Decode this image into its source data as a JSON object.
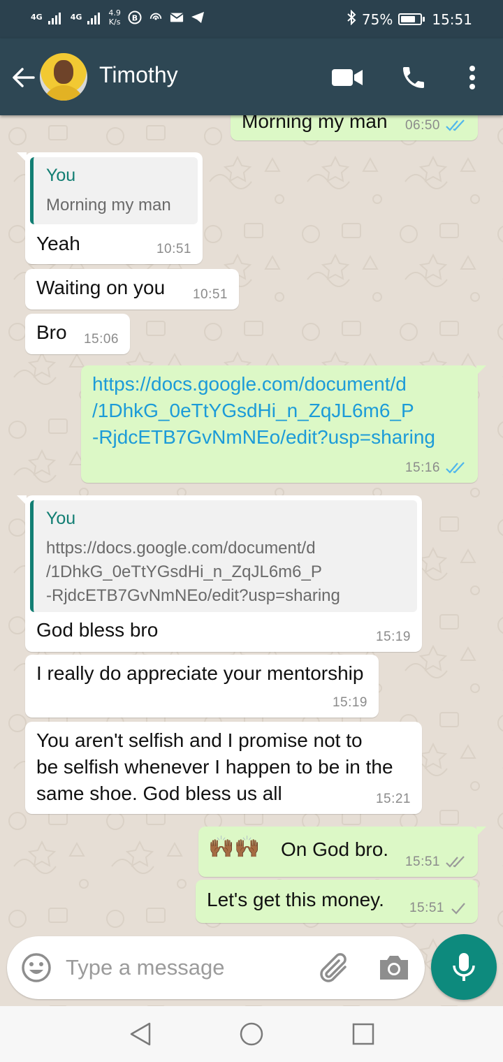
{
  "status_bar": {
    "network_1": "4G",
    "network_2": "4G",
    "speed_value": "4.9",
    "speed_unit": "K/s",
    "battery": "75%",
    "battery_level": 0.75,
    "time": "15:51"
  },
  "header": {
    "contact_name": "Timothy",
    "icons": [
      "back-arrow-icon",
      "video-call-icon",
      "phone-icon",
      "more-vert-icon"
    ]
  },
  "messages": {
    "m0": {
      "text": "Morning my man",
      "time": "06:50",
      "status": "read"
    },
    "m1": {
      "quote_author": "You",
      "quote_text": "Morning my man",
      "text": "Yeah",
      "time": "10:51"
    },
    "m2": {
      "text": "Waiting on you",
      "time": "10:51"
    },
    "m3": {
      "text": "Bro",
      "time": "15:06"
    },
    "m4": {
      "line1": "https://docs.google.com/document/d",
      "line2": "/1DhkG_0eTtYGsdHi_n_ZqJL6m6_P",
      "line3": "-RjdcETB7GvNmNEo/edit?usp=sharing",
      "time": "15:16",
      "status": "read"
    },
    "m5": {
      "quote_author": "You",
      "quote_line1": "https://docs.google.com/document/d",
      "quote_line2": "/1DhkG_0eTtYGsdHi_n_ZqJL6m6_P",
      "quote_line3": "-RjdcETB7GvNmNEo/edit?usp=sharing",
      "text": "God bless bro",
      "time": "15:19"
    },
    "m6": {
      "text": "I really do appreciate your mentorship",
      "time": "15:19"
    },
    "m7": {
      "line1": "You aren't selfish and I promise not to",
      "line2": "be selfish whenever I happen to be in the",
      "line3": "same shoe. God bless us all",
      "time": "15:21"
    },
    "m8": {
      "emoji": "🙌🏾🙌🏾",
      "text": "On God bro.",
      "time": "15:51",
      "status": "delivered"
    },
    "m9": {
      "text": "Let's get this money.",
      "time": "15:51",
      "status": "sent"
    }
  },
  "input": {
    "placeholder": "Type a message"
  },
  "colors": {
    "header": "#2e4754",
    "outgoing_bubble": "#dcf8c6",
    "incoming_bubble": "#ffffff",
    "quote_accent": "#127e73",
    "read_tick": "#4fb6ec",
    "mic_button": "#0d8a7d"
  }
}
